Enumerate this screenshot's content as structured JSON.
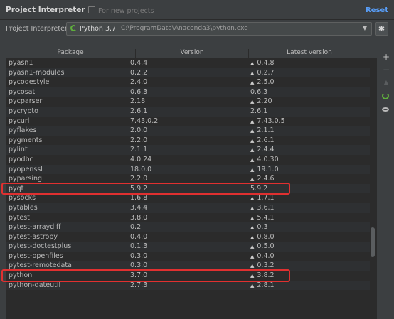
{
  "header": {
    "title": "Project Interpreter",
    "note": "For new projects",
    "reset": "Reset"
  },
  "interpreter": {
    "label": "Project Interpreter:",
    "name": "Python 3.7",
    "path": "C:\\ProgramData\\Anaconda3\\python.exe"
  },
  "table": {
    "columns": [
      "Package",
      "Version",
      "Latest version"
    ],
    "rows": [
      {
        "package": "pyasn1",
        "version": "0.4.4",
        "latest": "0.4.8",
        "upgrade": true
      },
      {
        "package": "pyasn1-modules",
        "version": "0.2.2",
        "latest": "0.2.7",
        "upgrade": true
      },
      {
        "package": "pycodestyle",
        "version": "2.4.0",
        "latest": "2.5.0",
        "upgrade": true
      },
      {
        "package": "pycosat",
        "version": "0.6.3",
        "latest": "0.6.3",
        "upgrade": false
      },
      {
        "package": "pycparser",
        "version": "2.18",
        "latest": "2.20",
        "upgrade": true
      },
      {
        "package": "pycrypto",
        "version": "2.6.1",
        "latest": "2.6.1",
        "upgrade": false
      },
      {
        "package": "pycurl",
        "version": "7.43.0.2",
        "latest": "7.43.0.5",
        "upgrade": true
      },
      {
        "package": "pyflakes",
        "version": "2.0.0",
        "latest": "2.1.1",
        "upgrade": true
      },
      {
        "package": "pygments",
        "version": "2.2.0",
        "latest": "2.6.1",
        "upgrade": true
      },
      {
        "package": "pylint",
        "version": "2.1.1",
        "latest": "2.4.4",
        "upgrade": true
      },
      {
        "package": "pyodbc",
        "version": "4.0.24",
        "latest": "4.0.30",
        "upgrade": true
      },
      {
        "package": "pyopenssl",
        "version": "18.0.0",
        "latest": "19.1.0",
        "upgrade": true
      },
      {
        "package": "pyparsing",
        "version": "2.2.0",
        "latest": "2.4.6",
        "upgrade": true
      },
      {
        "package": "pyqt",
        "version": "5.9.2",
        "latest": "5.9.2",
        "upgrade": false
      },
      {
        "package": "pysocks",
        "version": "1.6.8",
        "latest": "1.7.1",
        "upgrade": true
      },
      {
        "package": "pytables",
        "version": "3.4.4",
        "latest": "3.6.1",
        "upgrade": true
      },
      {
        "package": "pytest",
        "version": "3.8.0",
        "latest": "5.4.1",
        "upgrade": true
      },
      {
        "package": "pytest-arraydiff",
        "version": "0.2",
        "latest": "0.3",
        "upgrade": true
      },
      {
        "package": "pytest-astropy",
        "version": "0.4.0",
        "latest": "0.8.0",
        "upgrade": true
      },
      {
        "package": "pytest-doctestplus",
        "version": "0.1.3",
        "latest": "0.5.0",
        "upgrade": true
      },
      {
        "package": "pytest-openfiles",
        "version": "0.3.0",
        "latest": "0.4.0",
        "upgrade": true
      },
      {
        "package": "pytest-remotedata",
        "version": "0.3.0",
        "latest": "0.3.2",
        "upgrade": true
      },
      {
        "package": "python",
        "version": "3.7.0",
        "latest": "3.8.2",
        "upgrade": true
      },
      {
        "package": "python-dateutil",
        "version": "2.7.3",
        "latest": "2.8.1",
        "upgrade": true
      }
    ]
  },
  "highlighted_packages": [
    "pyqt",
    "python"
  ],
  "icons": {
    "add": "plus-icon",
    "remove": "minus-icon",
    "upgrade": "up-arrow-icon",
    "loading": "loading-spinner-icon",
    "show_early": "eye-icon",
    "settings": "gear-icon"
  },
  "colors": {
    "accent": "#589df6",
    "python_icon": "#5faf3c",
    "highlight_box": "#e03030"
  }
}
